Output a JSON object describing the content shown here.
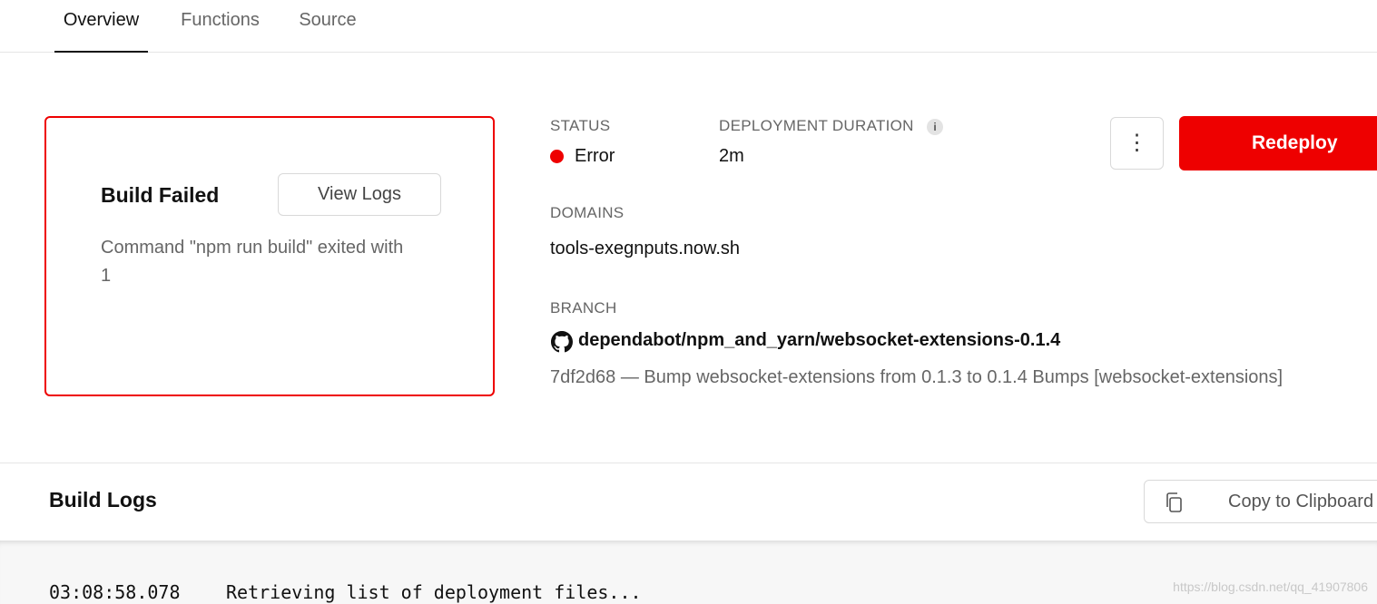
{
  "tabs": [
    {
      "label": "Overview",
      "active": true
    },
    {
      "label": "Functions",
      "active": false
    },
    {
      "label": "Source",
      "active": false
    }
  ],
  "error_card": {
    "title": "Build Failed",
    "view_logs_label": "View Logs",
    "message": "Command \"npm run build\" exited with 1"
  },
  "status": {
    "label": "STATUS",
    "value": "Error",
    "color": "#ee0000"
  },
  "duration": {
    "label": "DEPLOYMENT DURATION",
    "value": "2m",
    "info_icon": "info-icon"
  },
  "domains": {
    "label": "DOMAINS",
    "value": "tools-exegnputs.now.sh"
  },
  "branch": {
    "label": "BRANCH",
    "name": "dependabot/npm_and_yarn/websocket-extensions-0.1.4",
    "icon": "github-icon",
    "commit": "7df2d68 — Bump websocket-extensions from 0.1.3 to 0.1.4 Bumps [websocket-extensions]"
  },
  "actions": {
    "more_icon": "more-vertical-icon",
    "redeploy_label": "Redeploy",
    "accent": "#ee0000"
  },
  "build_logs": {
    "title": "Build Logs",
    "copy_label": "Copy to Clipboard",
    "copy_icon": "copy-icon",
    "lines": [
      {
        "time": "03:08:58.078",
        "text": "Retrieving list of deployment files..."
      }
    ]
  },
  "watermark": "https://blog.csdn.net/qq_41907806"
}
